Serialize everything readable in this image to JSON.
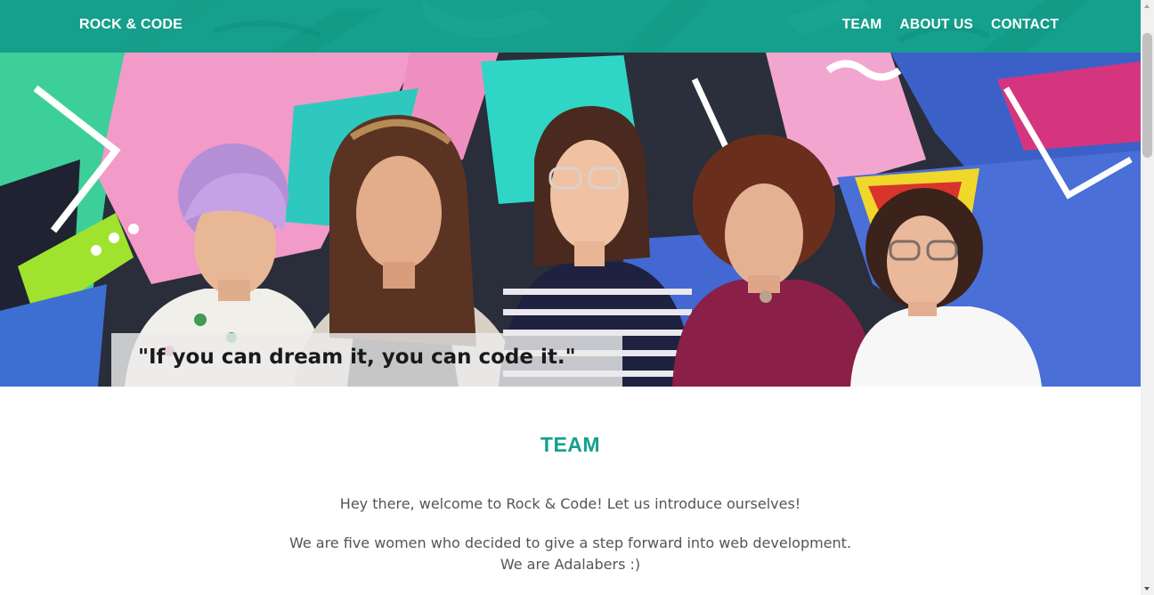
{
  "header": {
    "brand": "ROCK & CODE",
    "nav": [
      {
        "label": "TEAM"
      },
      {
        "label": "ABOUT US"
      },
      {
        "label": "CONTACT"
      }
    ]
  },
  "hero": {
    "quote": "\"If you can dream it, you can code it.\""
  },
  "team": {
    "title": "TEAM",
    "intro_1": "Hey there, welcome to Rock & Code! Let us introduce ourselves!",
    "intro_2_line_1": "We are five women who decided to give a step forward into web development.",
    "intro_2_line_2": "We are Adalabers :)"
  },
  "colors": {
    "accent": "#14a08c",
    "body_text": "#555555"
  }
}
